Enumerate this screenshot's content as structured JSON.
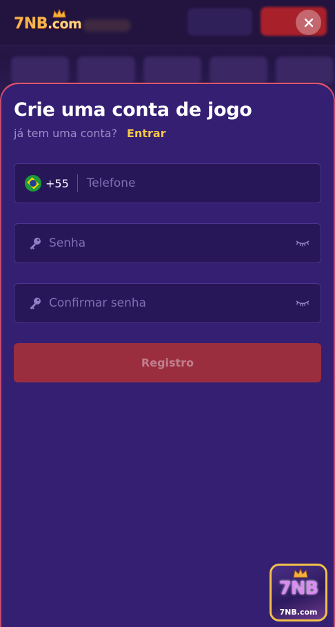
{
  "background": {
    "logo_text": "7NB",
    "logo_suffix": ".com"
  },
  "modal": {
    "title": "Crie uma conta de jogo",
    "have_account_text": "já tem uma conta?",
    "login_link": "Entrar",
    "phone": {
      "country_code": "+55",
      "country_flag": "brazil-flag",
      "placeholder": "Telefone"
    },
    "password": {
      "placeholder": "Senha",
      "icon": "key-icon",
      "toggle_icon": "eye-closed-icon"
    },
    "confirm_password": {
      "placeholder": "Confirmar senha",
      "icon": "key-icon",
      "toggle_icon": "eye-closed-icon"
    },
    "register_button": "Registro"
  },
  "badge": {
    "logo_text": "7NB",
    "label": "7NB.com"
  },
  "colors": {
    "sheet_bg": "#341f73",
    "accent_link": "#f7c948",
    "button_bg": "#9b2e3e",
    "field_bg": "#271758"
  }
}
